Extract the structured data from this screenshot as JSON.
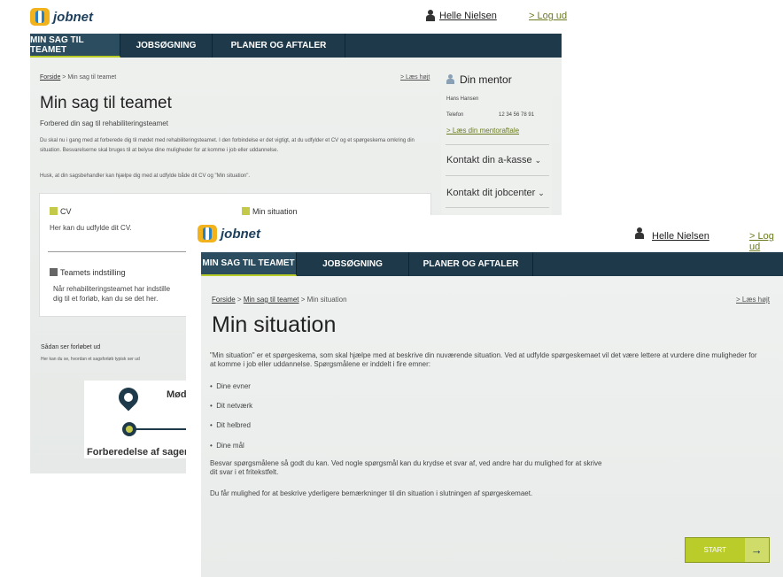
{
  "logo_text": "jobnet",
  "user_name": "Helle Nielsen",
  "logout": "> Log ud",
  "nav": [
    "MIN SAG TIL TEAMET",
    "JOBSØGNING",
    "PLANER OG AFTALER"
  ],
  "read_aloud": "> Læs højt",
  "back": {
    "breadcrumb_home": "Forside",
    "breadcrumb_rest": " > Min sag til teamet",
    "title": "Min sag til teamet",
    "subtitle": "Forbered din sag til rehabiliteringsteamet",
    "para1": "Du skal nu i gang med at forberede dig til mødet med rehabiliteringsteamet. I den forbindelse er det vigtigt, at du udfylder et CV og et spørgeskema omkring din situation. Besvarelserne skal bruges til at belyse dine muligheder for at komme i job eller uddannelse.",
    "para2": "Husk, at din sagsbehandler kan hjælpe dig med at udfylde både dit CV og \"Min situation\".",
    "card_cv_title": "CV",
    "card_cv_text": "Her kan du udfylde dit CV.",
    "card_sit_title": "Min situation",
    "card_team_title": "Teamets indstilling",
    "card_team_text_1": "Når rehabiliteringsteamet har indstille",
    "card_team_text_2": "dig til et forløb, kan du se det her.",
    "forloeb_title": "Sådan ser forløbet ud",
    "forloeb_text": "Her kan du se, hvordan et sagsforløb typisk ser ud",
    "timeline_mod": "Mød",
    "timeline_label": "Forberedelse af sagen",
    "mentor_title": "Din mentor",
    "mentor_name": "Hans Hansen",
    "mentor_phone_label": "Telefon",
    "mentor_phone": "12 34 56 78 91",
    "mentor_link": "> Læs din mentoraftale",
    "akasse": "Kontakt din a-kasse",
    "jobcenter": "Kontakt dit jobcenter"
  },
  "front": {
    "breadcrumb_home": "Forside",
    "breadcrumb_mid": "Min sag til teamet",
    "breadcrumb_end": "Min situation",
    "title": "Min situation",
    "intro": "\"Min situation\" er et spørgeskema, som skal hjælpe med at beskrive din nuværende situation. Ved at udfylde spørgeskemaet vil det være lettere at vurdere dine muligheder for at komme i job eller uddannelse. Spørgsmålene er inddelt i fire emner:",
    "bullets": [
      "Dine evner",
      "Dit netværk",
      "Dit helbred",
      "Dine mål"
    ],
    "answer_1": "Besvar spørgsmålene så godt du kan. Ved nogle spørgsmål kan du krydse et svar af, ved andre har du mulighed for at skrive",
    "answer_2": "dit svar i et fritekstfelt.",
    "remarks": "Du får mulighed for at beskrive yderligere bemærkninger til din situation i slutningen af spørgeskemaet.",
    "start": "START",
    "arrow": "→"
  },
  "colors": {
    "nav": "#1e3a4a",
    "accent": "#b9cc2a",
    "logout": "#6a7a1f"
  }
}
